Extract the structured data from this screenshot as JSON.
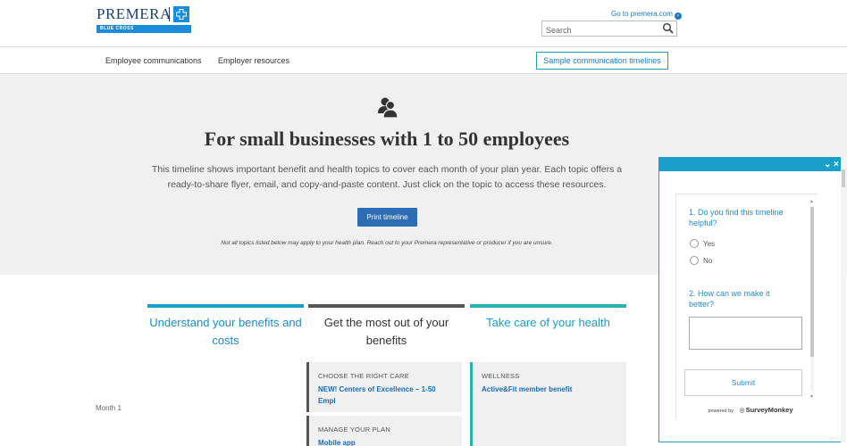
{
  "header": {
    "logo_text": "PREMERA",
    "logo_sub": "BLUE CROSS",
    "goto_link": "Go to premera.com",
    "search_placeholder": "Search"
  },
  "nav": {
    "items": [
      {
        "label": "Employee communications"
      },
      {
        "label": "Employer resources"
      }
    ],
    "button": "Sample communication timelines"
  },
  "hero": {
    "title": "For small businesses with 1 to 50 employees",
    "description": "This timeline shows important benefit and health topics to cover each month of your plan year. Each topic offers a ready-to-share flyer, email, and copy-and-paste content. Just click on the topic to access these resources.",
    "print_button": "Print timeline",
    "note": "Not all topics listed below may apply to your health plan. Reach out to your Premera representative or producer if you are unsure."
  },
  "columns": [
    {
      "title": "Understand your benefits and costs",
      "color": "#1aa0c8",
      "text_color": "#1a8cc4"
    },
    {
      "title": "Get the most out of your benefits",
      "color": "#555555",
      "text_color": "#333333"
    },
    {
      "title": "Take care of your health",
      "color": "#2ab0b5",
      "text_color": "#1a9cc4"
    }
  ],
  "month_label": "Month 1",
  "cards": [
    {
      "category": "CHOOSE THE RIGHT CARE",
      "link": "NEW! Centers of Excellence – 1-50 Empl",
      "accent": "#555555"
    },
    {
      "category": "MANAGE YOUR PLAN",
      "link": "Mobile app",
      "accent": "#555555"
    },
    {
      "category": "WELLNESS",
      "link": "Active&Fit member benefit",
      "accent": "#2ab0b5"
    }
  ],
  "survey": {
    "q1": "1. Do you find this timeline helpful?",
    "opt_yes": "Yes",
    "opt_no": "No",
    "q2": "2. How can we make it better?",
    "submit": "Submit",
    "powered_by": "powered by",
    "brand": "SurveyMonkey",
    "accent": "#1aa0c8"
  }
}
